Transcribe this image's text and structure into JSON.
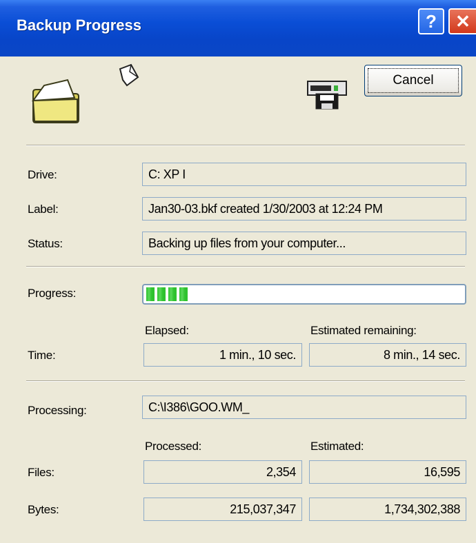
{
  "window": {
    "title": "Backup Progress",
    "help_label": "?",
    "close_label": "✕"
  },
  "icons": [
    "folder-icon",
    "paper-icon",
    "drive-icon"
  ],
  "cancel_label": "Cancel",
  "info": {
    "drive_label": "Drive:",
    "drive_value": "C: XP I",
    "label_label": "Label:",
    "label_value": "Jan30-03.bkf created 1/30/2003 at 12:24 PM",
    "status_label": "Status:",
    "status_value": "Backing up files from your computer..."
  },
  "progress": {
    "label": "Progress:",
    "fraction": 0.14
  },
  "time": {
    "elapsed_header": "Elapsed:",
    "remaining_header": "Estimated remaining:",
    "label": "Time:",
    "elapsed_value": "1 min., 10 sec.",
    "remaining_value": "8 min., 14 sec."
  },
  "processing": {
    "label": "Processing:",
    "value": "C:\\I386\\GOO.WM_"
  },
  "counts": {
    "processed_header": "Processed:",
    "estimated_header": "Estimated:",
    "files_label": "Files:",
    "files_processed": "2,354",
    "files_estimated": "16,595",
    "bytes_label": "Bytes:",
    "bytes_processed": "215,037,347",
    "bytes_estimated": "1,734,302,388"
  },
  "colors": {
    "titlebar": "#0a4ed6",
    "dialog_bg": "#ece9d8",
    "progress_green": "#2ec22e",
    "field_border": "#8daac8"
  }
}
